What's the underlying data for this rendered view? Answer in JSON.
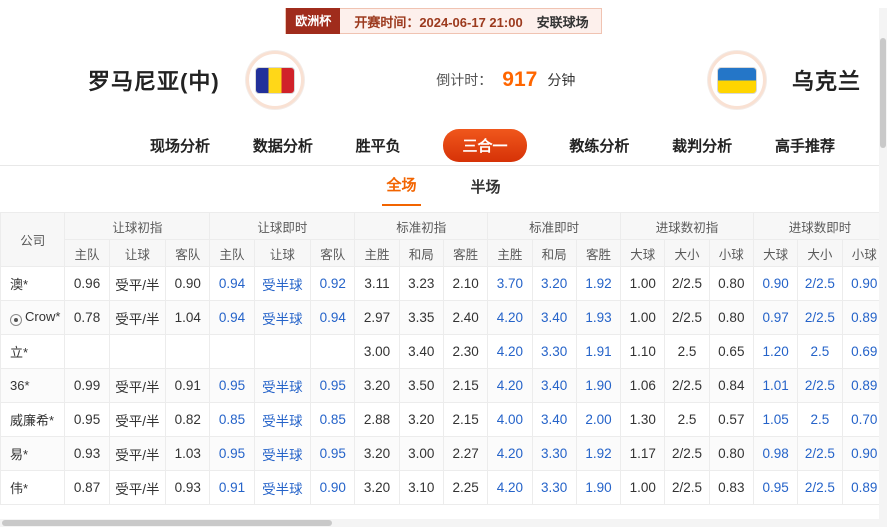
{
  "colors": {
    "accent": "#f26400",
    "live_blue": "#2563c9",
    "badge_red": "#a02c1c",
    "countdown_orange": "#ff6600"
  },
  "header": {
    "league_badge": "欧洲杯",
    "kickoff_label": "开赛时间：2024-06-17 21:00",
    "venue": "安联球场",
    "home_team": "罗马尼亚(中)",
    "away_team": "乌克兰",
    "countdown_label": "倒计时：",
    "countdown_value": "917",
    "countdown_unit": "分钟",
    "home_flag_colors": [
      "#21309a",
      "#ffd718",
      "#d0222a"
    ],
    "away_flag_colors": [
      "#2476c8",
      "#ffd500"
    ]
  },
  "nav": {
    "tabs": [
      {
        "name": "live-analysis",
        "label": "现场分析",
        "active": false
      },
      {
        "name": "data-analysis",
        "label": "数据分析",
        "active": false
      },
      {
        "name": "win-draw-loss",
        "label": "胜平负",
        "active": false
      },
      {
        "name": "three-in-one",
        "label": "三合一",
        "active": true
      },
      {
        "name": "coach-analysis",
        "label": "教练分析",
        "active": false
      },
      {
        "name": "referee-analysis",
        "label": "裁判分析",
        "active": false
      },
      {
        "name": "expert-picks",
        "label": "高手推荐",
        "active": false
      }
    ]
  },
  "subtabs": [
    {
      "name": "full-match",
      "label": "全场",
      "active": true
    },
    {
      "name": "half-match",
      "label": "半场",
      "active": false
    }
  ],
  "table": {
    "company_header": "公司",
    "groups": [
      {
        "label": "让球初指",
        "cols": [
          "主队",
          "让球",
          "客队"
        ],
        "live": false
      },
      {
        "label": "让球即时",
        "cols": [
          "主队",
          "让球",
          "客队"
        ],
        "live": true
      },
      {
        "label": "标准初指",
        "cols": [
          "主胜",
          "和局",
          "客胜"
        ],
        "live": false
      },
      {
        "label": "标准即时",
        "cols": [
          "主胜",
          "和局",
          "客胜"
        ],
        "live": true
      },
      {
        "label": "进球数初指",
        "cols": [
          "大球",
          "大小",
          "小球"
        ],
        "live": false
      },
      {
        "label": "进球数即时",
        "cols": [
          "大球",
          "大小",
          "小球"
        ],
        "live": true
      }
    ],
    "rows": [
      {
        "company": "澳*",
        "has_icon": false,
        "cells": [
          "0.96",
          "受平/半",
          "0.90",
          "0.94",
          "受半球",
          "0.92",
          "3.11",
          "3.23",
          "2.10",
          "3.70",
          "3.20",
          "1.92",
          "1.00",
          "2/2.5",
          "0.80",
          "0.90",
          "2/2.5",
          "0.90"
        ]
      },
      {
        "company": "Crow*",
        "has_icon": true,
        "cells": [
          "0.78",
          "受平/半",
          "1.04",
          "0.94",
          "受半球",
          "0.94",
          "2.97",
          "3.35",
          "2.40",
          "4.20",
          "3.40",
          "1.93",
          "1.00",
          "2/2.5",
          "0.80",
          "0.97",
          "2/2.5",
          "0.89"
        ]
      },
      {
        "company": "立*",
        "has_icon": false,
        "cells": [
          "",
          "",
          "",
          "",
          "",
          "",
          "3.00",
          "3.40",
          "2.30",
          "4.20",
          "3.30",
          "1.91",
          "1.10",
          "2.5",
          "0.65",
          "1.20",
          "2.5",
          "0.69"
        ]
      },
      {
        "company": "36*",
        "has_icon": false,
        "cells": [
          "0.99",
          "受平/半",
          "0.91",
          "0.95",
          "受半球",
          "0.95",
          "3.20",
          "3.50",
          "2.15",
          "4.20",
          "3.40",
          "1.90",
          "1.06",
          "2/2.5",
          "0.84",
          "1.01",
          "2/2.5",
          "0.89"
        ]
      },
      {
        "company": "威廉希*",
        "has_icon": false,
        "cells": [
          "0.95",
          "受平/半",
          "0.82",
          "0.85",
          "受半球",
          "0.85",
          "2.88",
          "3.20",
          "2.15",
          "4.00",
          "3.40",
          "2.00",
          "1.30",
          "2.5",
          "0.57",
          "1.05",
          "2.5",
          "0.70"
        ]
      },
      {
        "company": "易*",
        "has_icon": false,
        "cells": [
          "0.93",
          "受平/半",
          "1.03",
          "0.95",
          "受半球",
          "0.95",
          "3.20",
          "3.00",
          "2.27",
          "4.20",
          "3.30",
          "1.92",
          "1.17",
          "2/2.5",
          "0.80",
          "0.98",
          "2/2.5",
          "0.90"
        ]
      },
      {
        "company": "伟*",
        "has_icon": false,
        "cells": [
          "0.87",
          "受平/半",
          "0.93",
          "0.91",
          "受半球",
          "0.90",
          "3.20",
          "3.10",
          "2.25",
          "4.20",
          "3.30",
          "1.90",
          "1.00",
          "2/2.5",
          "0.83",
          "0.95",
          "2/2.5",
          "0.89"
        ]
      }
    ]
  }
}
